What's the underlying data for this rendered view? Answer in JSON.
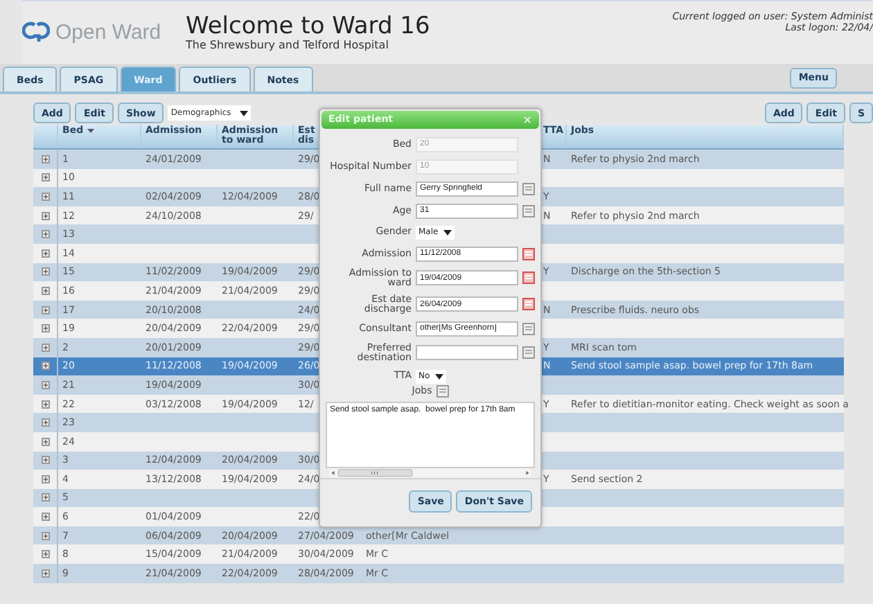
{
  "app": {
    "name": "Open Ward",
    "title": "Welcome to Ward 16",
    "subtitle": "The Shrewsbury and Telford Hospital",
    "user_line": "Current logged on user: System Administ",
    "logon_line": "Last logon: 22/04/"
  },
  "tabs": [
    {
      "label": "Beds",
      "selected": false
    },
    {
      "label": "PSAG",
      "selected": false
    },
    {
      "label": "Ward",
      "selected": true
    },
    {
      "label": "Outliers",
      "selected": false
    },
    {
      "label": "Notes",
      "selected": false
    }
  ],
  "menu_button": "Menu",
  "toolbar": {
    "left_buttons": [
      "Add",
      "Edit",
      "Show"
    ],
    "view_select": "Demographics",
    "right_buttons": [
      "Add",
      "Edit",
      "S"
    ]
  },
  "table": {
    "columns": {
      "bed": "Bed",
      "admission": "Admission",
      "admission_to_ward": "Admission to ward",
      "est_discharge": "Est dis",
      "tta": "TTA",
      "jobs": "Jobs"
    },
    "rows": [
      {
        "bed": "1",
        "admission": "24/01/2009",
        "est_discharge": "29/0",
        "tta": "N",
        "jobs": "Refer to physio 2nd march",
        "selected": false
      },
      {
        "bed": "10",
        "selected": false
      },
      {
        "bed": "11",
        "admission": "02/04/2009",
        "admission_to_ward": "12/04/2009",
        "est_discharge": "28/0",
        "tta": "Y",
        "selected": false
      },
      {
        "bed": "12",
        "admission": "24/10/2008",
        "est_discharge": "29/",
        "tta": "N",
        "jobs": "Refer to physio 2nd march",
        "selected": false
      },
      {
        "bed": "13",
        "selected": false
      },
      {
        "bed": "14",
        "selected": false
      },
      {
        "bed": "15",
        "admission": "11/02/2009",
        "admission_to_ward": "19/04/2009",
        "est_discharge": "29/0",
        "tta": "Y",
        "jobs": "Discharge on the 5th-section 5",
        "selected": false
      },
      {
        "bed": "16",
        "admission": "21/04/2009",
        "admission_to_ward": "21/04/2009",
        "est_discharge": "29/0",
        "selected": false
      },
      {
        "bed": "17",
        "admission": "20/10/2008",
        "est_discharge": "24/0",
        "tta": "N",
        "jobs": "Prescribe fluids. neuro obs",
        "selected": false
      },
      {
        "bed": "19",
        "admission": "20/04/2009",
        "admission_to_ward": "22/04/2009",
        "est_discharge": "29/0",
        "selected": false
      },
      {
        "bed": "2",
        "admission": "20/01/2009",
        "est_discharge": "29/0",
        "tta": "Y",
        "jobs": "MRI scan tom",
        "selected": false
      },
      {
        "bed": "20",
        "admission": "11/12/2008",
        "admission_to_ward": "19/04/2009",
        "est_discharge": "26/0",
        "tta": "N",
        "jobs": "Send stool sample asap. bowel prep for 17th 8am",
        "selected": true
      },
      {
        "bed": "21",
        "admission": "19/04/2009",
        "est_discharge": "30/0",
        "selected": false
      },
      {
        "bed": "22",
        "admission": "03/12/2008",
        "admission_to_ward": "19/04/2009",
        "est_discharge": "12/",
        "tta": "Y",
        "jobs": "Refer to dietitian-monitor eating. Check weight as soon a",
        "selected": false
      },
      {
        "bed": "23",
        "selected": false
      },
      {
        "bed": "24",
        "selected": false
      },
      {
        "bed": "3",
        "admission": "12/04/2009",
        "admission_to_ward": "20/04/2009",
        "est_discharge": "30/0",
        "selected": false
      },
      {
        "bed": "4",
        "admission": "13/12/2008",
        "admission_to_ward": "19/04/2009",
        "est_discharge": "24/0",
        "tta": "Y",
        "jobs": "Send section 2",
        "selected": false
      },
      {
        "bed": "5",
        "selected": false
      },
      {
        "bed": "6",
        "admission": "01/04/2009",
        "est_discharge": "22/0",
        "selected": false
      },
      {
        "bed": "7",
        "admission": "06/04/2009",
        "admission_to_ward": "20/04/2009",
        "est_discharge": "27/04/2009",
        "column_6": "other[Mr Caldwel",
        "selected": false
      },
      {
        "bed": "8",
        "admission": "15/04/2009",
        "admission_to_ward": "21/04/2009",
        "est_discharge": "30/04/2009",
        "column_6": "Mr C",
        "selected": false
      },
      {
        "bed": "9",
        "admission": "21/04/2009",
        "admission_to_ward": "22/04/2009",
        "est_discharge": "28/04/2009",
        "column_6": "Mr C",
        "selected": false
      }
    ]
  },
  "dialog": {
    "title": "Edit patient",
    "close": "×",
    "fields": [
      {
        "label": "Bed",
        "value": "20",
        "kind": "text",
        "disabled": true
      },
      {
        "label": "Hospital Number",
        "value": "10",
        "kind": "text",
        "disabled": true
      },
      {
        "label": "Full name",
        "value": "Gerry Springfield",
        "kind": "lookup",
        "disabled": false
      },
      {
        "label": "Age",
        "value": "31",
        "kind": "lookup",
        "disabled": false
      },
      {
        "label": "Gender",
        "value": "Male",
        "kind": "select"
      },
      {
        "label": "Admission",
        "value": "11/12/2008",
        "kind": "date",
        "disabled": false
      },
      {
        "label": "Admission to ward",
        "value": "19/04/2009",
        "kind": "date",
        "disabled": false
      },
      {
        "label": "Est date discharge",
        "value": "26/04/2009",
        "kind": "date",
        "disabled": false
      },
      {
        "label": "Consultant",
        "value": "other[Ms Greenhorn]",
        "kind": "lookup",
        "disabled": false
      },
      {
        "label": "Preferred destination",
        "kind": "lookup",
        "disabled": false
      },
      {
        "label": "TTA",
        "value": "No",
        "kind": "select"
      }
    ],
    "jobs": {
      "label": "Jobs",
      "text": "Send stool sample asap.  bowel prep for 17th 8am"
    },
    "buttons": [
      "Save",
      "Don't Save"
    ]
  }
}
